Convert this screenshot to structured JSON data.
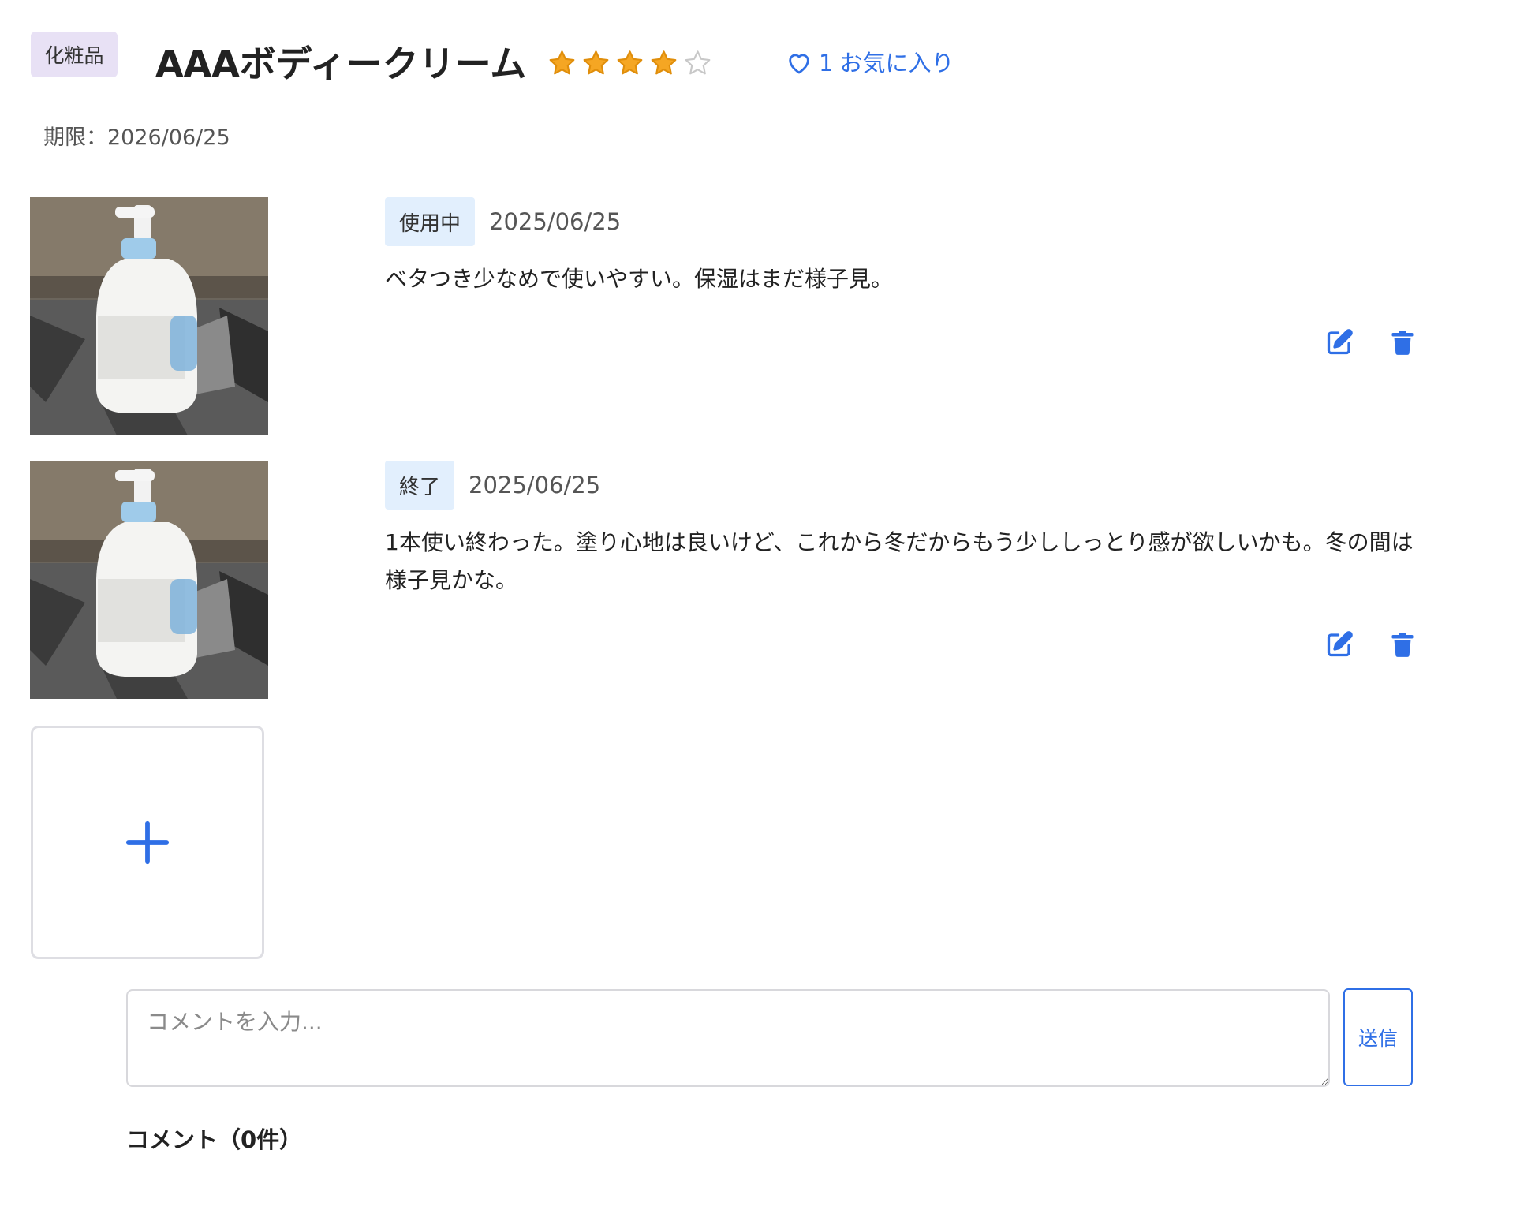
{
  "product": {
    "category": "化粧品",
    "title": "AAAボディークリーム",
    "rating": 4,
    "rating_max": 5,
    "favorites": {
      "count": "1",
      "label": "お気に入り"
    },
    "expiry": "期限：2026/06/25"
  },
  "entries": [
    {
      "status": "使用中",
      "date": "2025/06/25",
      "text": "ベタつき少なめで使いやすい。保湿はまだ様子見。"
    },
    {
      "status": "終了",
      "date": "2025/06/25",
      "text": "1本使い終わった。塗り心地は良いけど、これから冬だからもう少ししっとり感が欲しいかも。冬の間は様子見かな。"
    }
  ],
  "comment_form": {
    "placeholder": "コメントを入力...",
    "value": "",
    "submit_label": "送信"
  },
  "comments": {
    "heading": "コメント（0件）"
  },
  "colors": {
    "accent": "#2f6fe6",
    "category_badge_bg": "#e8e1f5",
    "status_badge_bg": "#e2effd",
    "star_filled": "#f5a623",
    "star_empty": "#c8c8c8"
  },
  "icons": {
    "rating": "star-icon",
    "favorite": "heart-icon",
    "edit": "edit-icon",
    "delete": "trash-icon",
    "add": "plus-icon"
  }
}
